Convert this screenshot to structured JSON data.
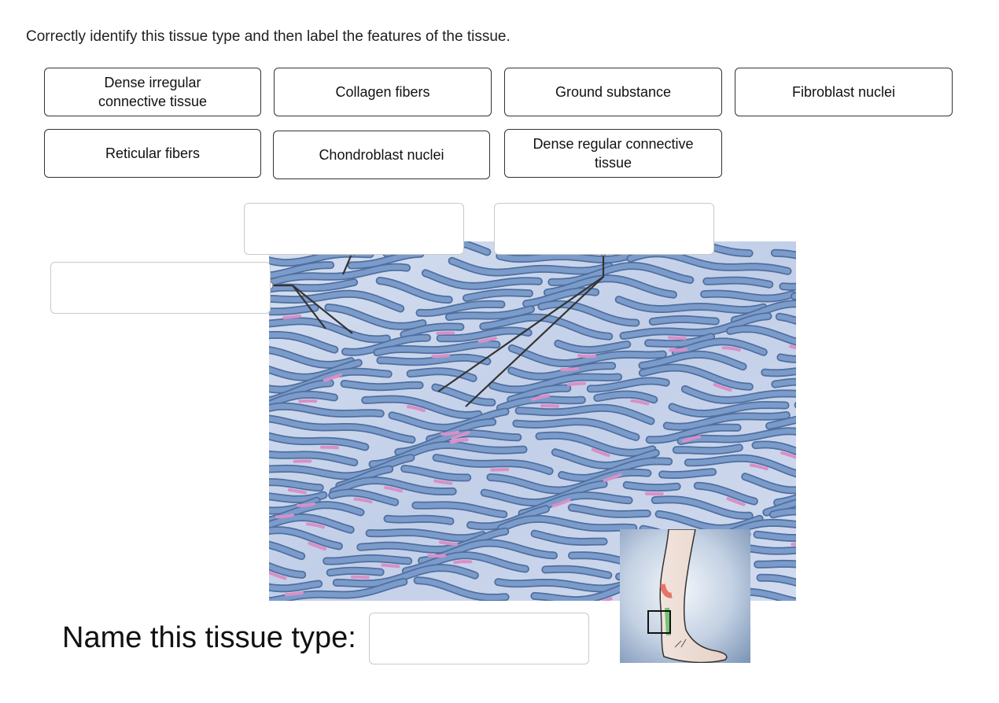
{
  "instruction": "Correctly identify this tissue type and then label the features of the tissue.",
  "choices": [
    {
      "label": "Dense irregular connective tissue"
    },
    {
      "label": "Collagen fibers"
    },
    {
      "label": "Ground substance"
    },
    {
      "label": "Fibroblast nuclei"
    },
    {
      "label": "Reticular fibers"
    },
    {
      "label": "Chondroblast nuclei"
    },
    {
      "label": "Dense regular connective tissue"
    }
  ],
  "drop_targets": [
    {
      "value": ""
    },
    {
      "value": ""
    },
    {
      "value": ""
    }
  ],
  "name_prompt": {
    "label": "Name this tissue type:",
    "value": ""
  },
  "colors": {
    "fiber_fill": "#7b9ccb",
    "fiber_edge": "#4f6f9f",
    "background": "#c9d5ea",
    "nucleus": "#d98fc7",
    "leader_line": "#333333"
  },
  "icons": {
    "illustration": "dense-regular-tissue-illustration",
    "inset": "leg-tendon-inset-icon"
  }
}
